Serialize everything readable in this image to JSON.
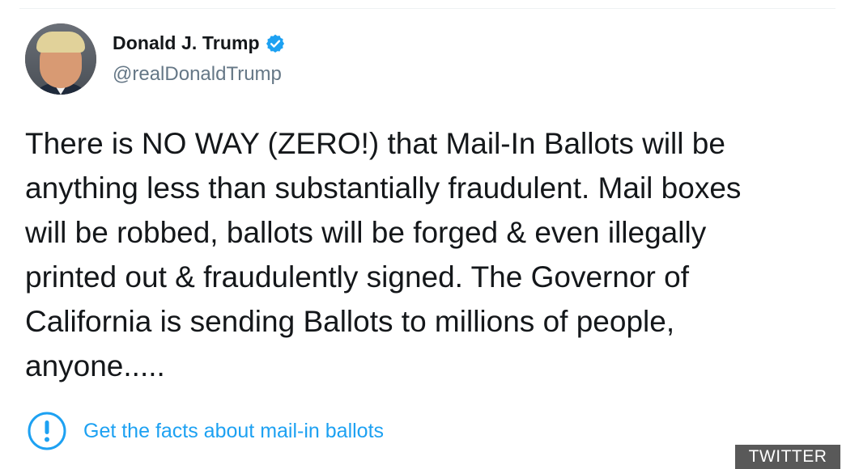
{
  "tweet": {
    "display_name": "Donald J. Trump",
    "handle": "@realDonaldTrump",
    "verified": true,
    "avatar_icon": "user-avatar-photo",
    "text": "There is NO WAY (ZERO!) that Mail-In Ballots will be\nanything less than substantially fraudulent. Mail boxes\nwill be robbed, ballots will be forged & even illegally\nprinted out & fraudulently signed. The Governor of\nCalifornia is sending Ballots to millions of people,\nanyone.....",
    "facts_label": "Get the facts about mail-in ballots",
    "facts_icon": "exclamation-circle-icon"
  },
  "source_badge": "TWITTER",
  "colors": {
    "link_blue": "#1da1f2",
    "text_dark": "#14171a",
    "text_muted": "#657786",
    "badge_gray": "#595959"
  }
}
